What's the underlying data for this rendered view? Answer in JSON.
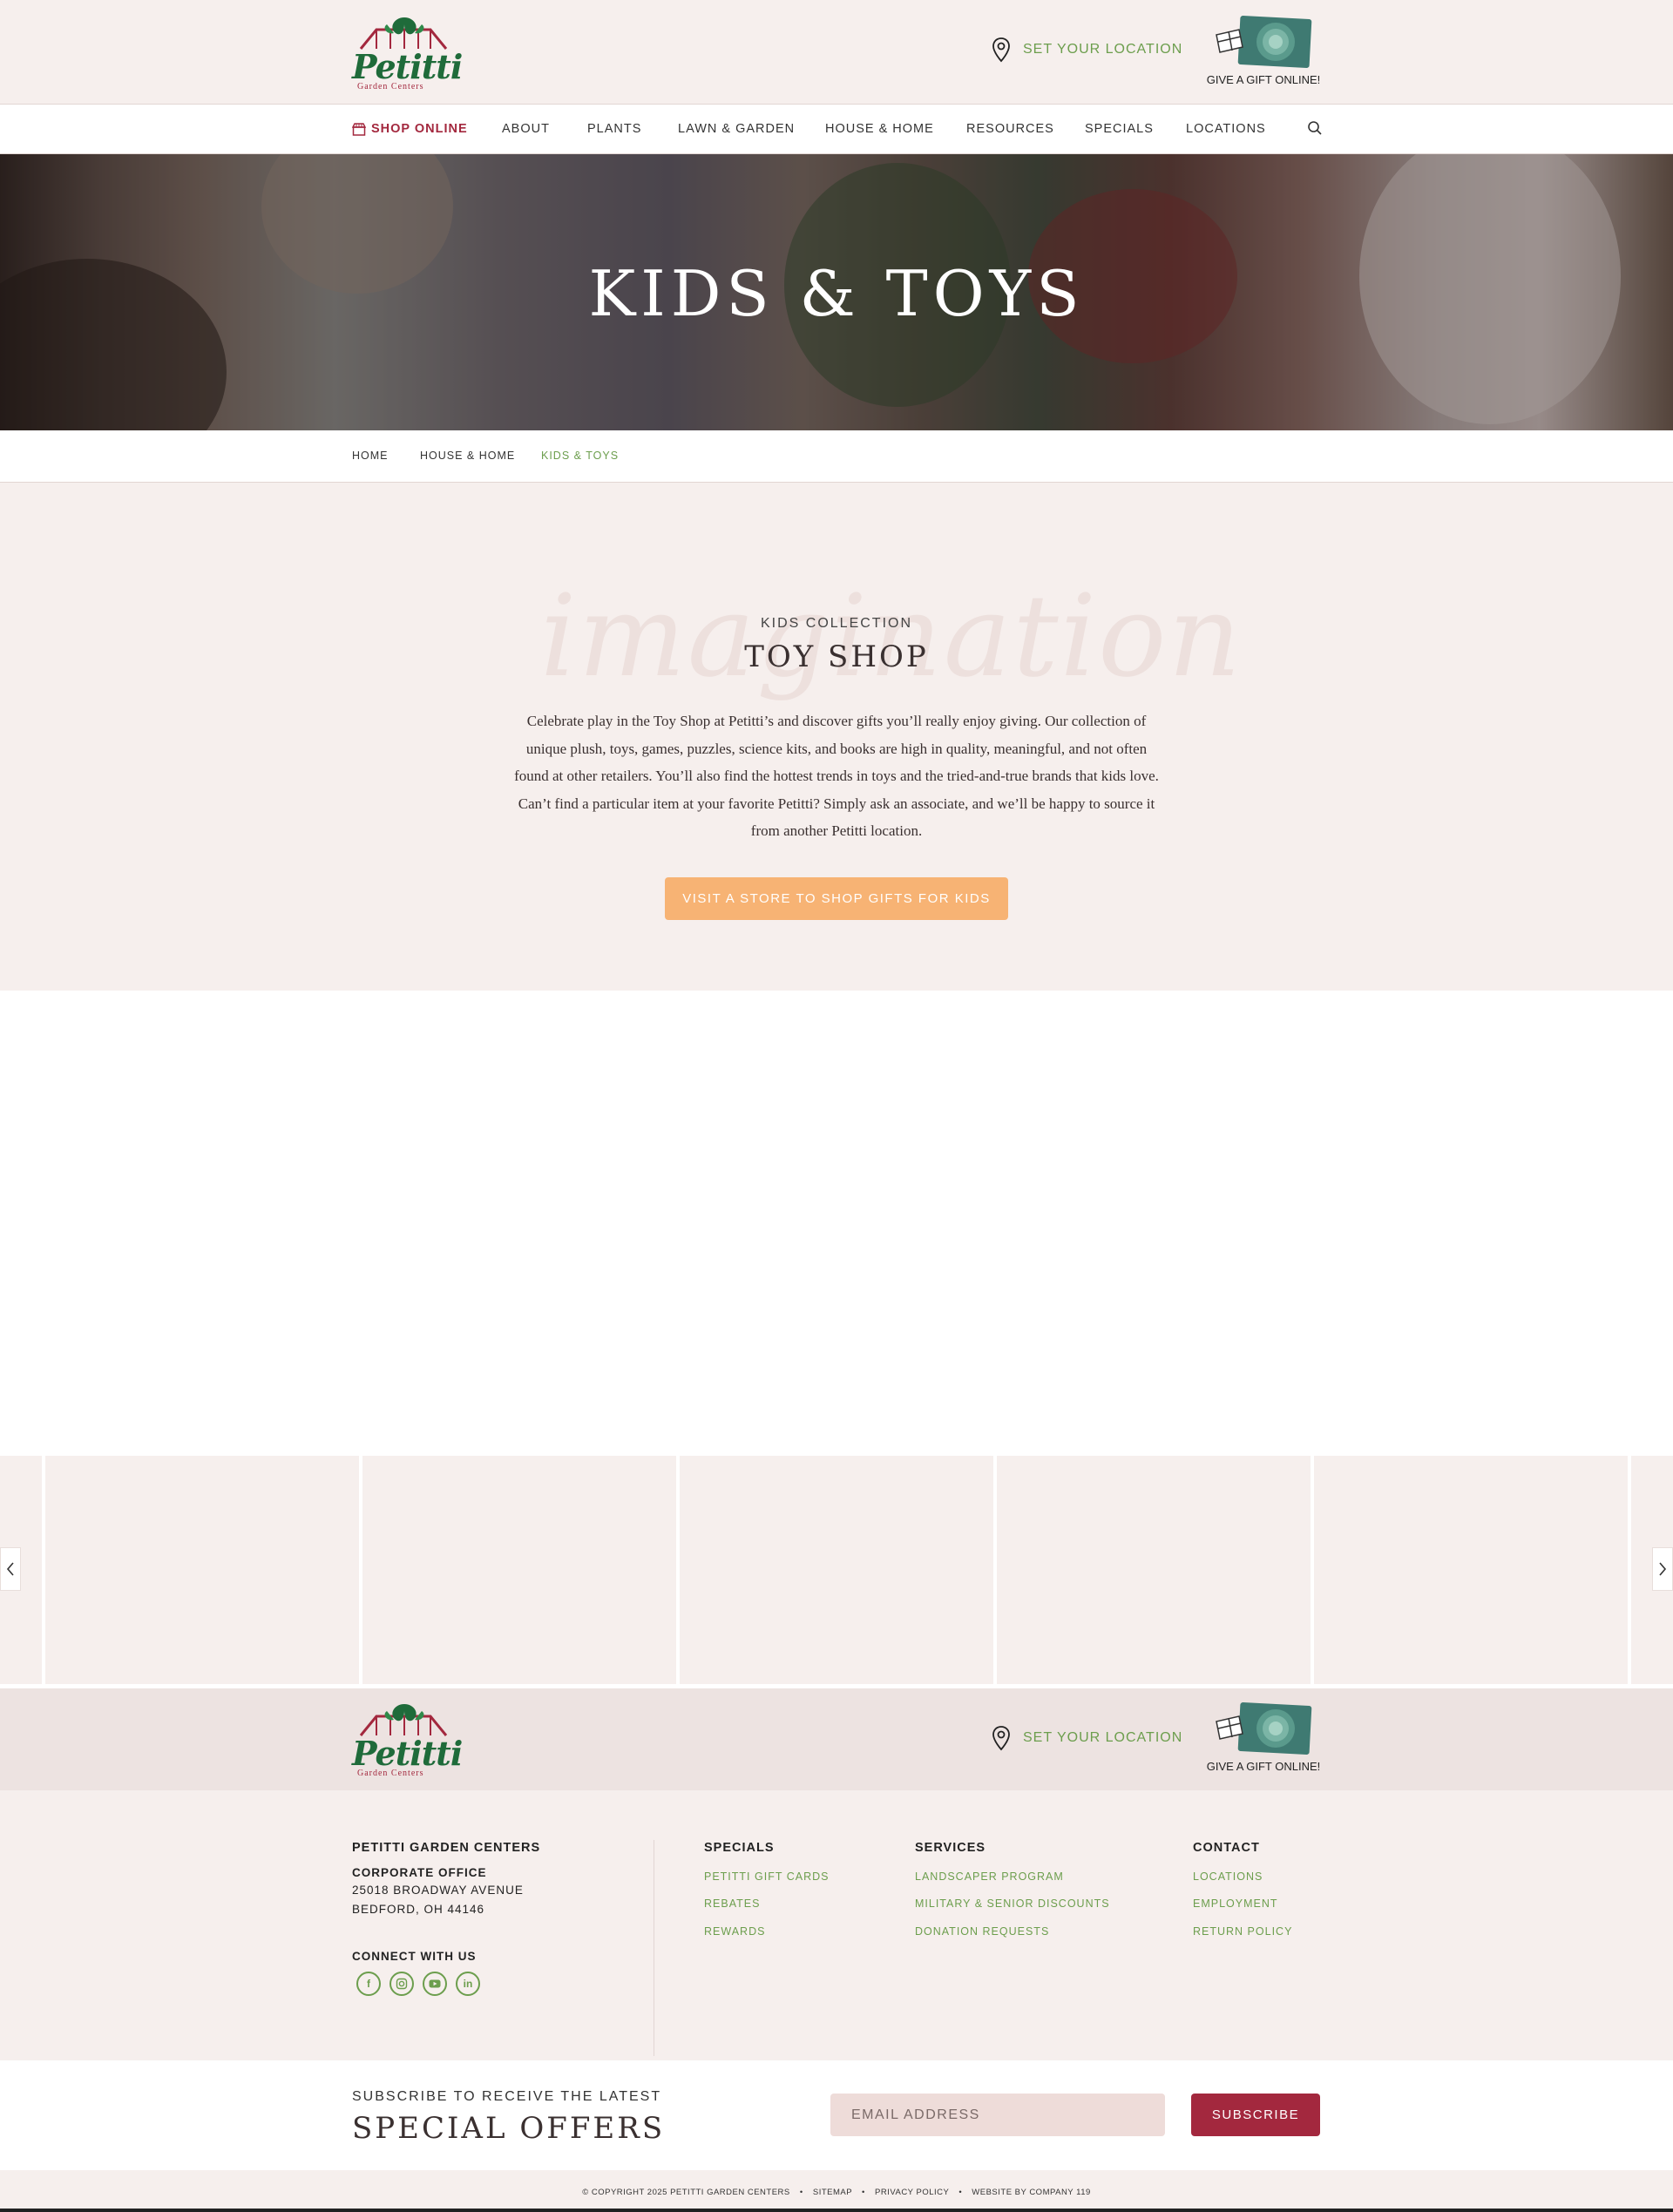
{
  "header": {
    "logo_word": "Petitti",
    "logo_sub": "Garden Centers",
    "location_label": "SET YOUR LOCATION",
    "gift_label": "GIVE A GIFT ONLINE!"
  },
  "nav": {
    "shop": "SHOP ONLINE",
    "items": [
      "ABOUT",
      "PLANTS",
      "LAWN & GARDEN",
      "HOUSE & HOME",
      "RESOURCES",
      "SPECIALS",
      "LOCATIONS"
    ]
  },
  "hero": {
    "title": "KIDS & TOYS"
  },
  "breadcrumb": [
    "HOME",
    "HOUSE & HOME",
    "KIDS & TOYS"
  ],
  "intro": {
    "script": "imagination",
    "kicker": "KIDS COLLECTION",
    "title": "TOY SHOP",
    "body": "Celebrate play in the Toy Shop at Petitti’s and discover gifts you’ll really enjoy giving. Our collection of unique plush, toys, games, puzzles, science kits, and books are high in quality, meaningful, and not often found at other retailers. You’ll also find the hottest trends in toys and the tried-and-true brands that kids love. Can’t find a particular item at your favorite Petitti? Simply ask an associate, and we’ll be happy to source it from another Petitti location.",
    "cta": "VISIT A STORE TO SHOP GIFTS FOR KIDS"
  },
  "footer": {
    "company": "PETITTI GARDEN CENTERS",
    "office_label": "CORPORATE OFFICE",
    "address1": "25018 BROADWAY AVENUE",
    "address2": "BEDFORD, OH 44146",
    "connect": "CONNECT WITH US",
    "social": [
      "facebook-icon",
      "instagram-icon",
      "youtube-icon",
      "linkedin-icon"
    ],
    "specials": {
      "title": "SPECIALS",
      "links": [
        "PETITTI GIFT CARDS",
        "REBATES",
        "REWARDS"
      ]
    },
    "services": {
      "title": "SERVICES",
      "links": [
        "LANDSCAPER PROGRAM",
        "MILITARY & SENIOR DISCOUNTS",
        "DONATION REQUESTS"
      ]
    },
    "contact": {
      "title": "CONTACT",
      "links": [
        "LOCATIONS",
        "EMPLOYMENT",
        "RETURN POLICY"
      ]
    }
  },
  "subscribe": {
    "kicker": "SUBSCRIBE TO RECEIVE THE LATEST",
    "title": "SPECIAL OFFERS",
    "placeholder": "EMAIL ADDRESS",
    "button": "SUBSCRIBE"
  },
  "copyright": {
    "text": "© COPYRIGHT 2025 PETITTI GARDEN CENTERS",
    "sitemap": "SITEMAP",
    "privacy": "PRIVACY POLICY",
    "credit": "WEBSITE BY COMPANY 119"
  },
  "colors": {
    "accent_green": "#6c9e4d",
    "brand_red": "#a3283e",
    "cta_orange": "#f7b374",
    "background": "#f6efed"
  }
}
